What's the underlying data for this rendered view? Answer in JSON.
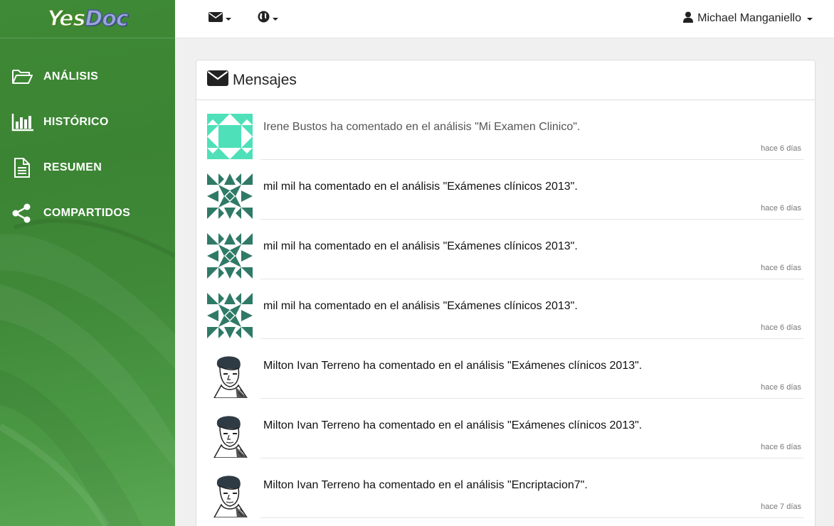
{
  "brand": {
    "logo_part1": "Yes",
    "logo_part2": "Doc"
  },
  "sidebar": {
    "items": [
      {
        "label": "ANÁLISIS",
        "icon": "folder-open-icon"
      },
      {
        "label": "HISTÓRICO",
        "icon": "bar-chart-icon"
      },
      {
        "label": "RESUMEN",
        "icon": "document-icon"
      },
      {
        "label": "COMPARTIDOS",
        "icon": "share-icon"
      }
    ]
  },
  "topbar": {
    "mail_icon": "envelope-icon",
    "globe_icon": "globe-icon",
    "user_name": "Michael Manganiello",
    "user_icon": "user-icon"
  },
  "panel": {
    "title": "Mensajes",
    "title_icon": "envelope-icon"
  },
  "messages": [
    {
      "text": "Irene Bustos ha comentado en el análisis \"Mi Examen Clinico\".",
      "time": "hace 6 días",
      "avatar": "identicon-teal-light"
    },
    {
      "text": "mil mil ha comentado en el análisis \"Exámenes clínicos 2013\".",
      "time": "hace 6 días",
      "avatar": "identicon-teal-dark"
    },
    {
      "text": "mil mil ha comentado en el análisis \"Exámenes clínicos 2013\".",
      "time": "hace 6 días",
      "avatar": "identicon-teal-dark"
    },
    {
      "text": "mil mil ha comentado en el análisis \"Exámenes clínicos 2013\".",
      "time": "hace 6 días",
      "avatar": "identicon-teal-dark"
    },
    {
      "text": "Milton Ivan Terreno ha comentado en el análisis \"Exámenes clínicos 2013\".",
      "time": "hace 6 días",
      "avatar": "portrait-sketch"
    },
    {
      "text": "Milton Ivan Terreno ha comentado en el análisis \"Exámenes clínicos 2013\".",
      "time": "hace 6 días",
      "avatar": "portrait-sketch"
    },
    {
      "text": "Milton Ivan Terreno ha comentado en el análisis \"Encriptacion7\".",
      "time": "hace 7 días",
      "avatar": "portrait-sketch"
    }
  ]
}
